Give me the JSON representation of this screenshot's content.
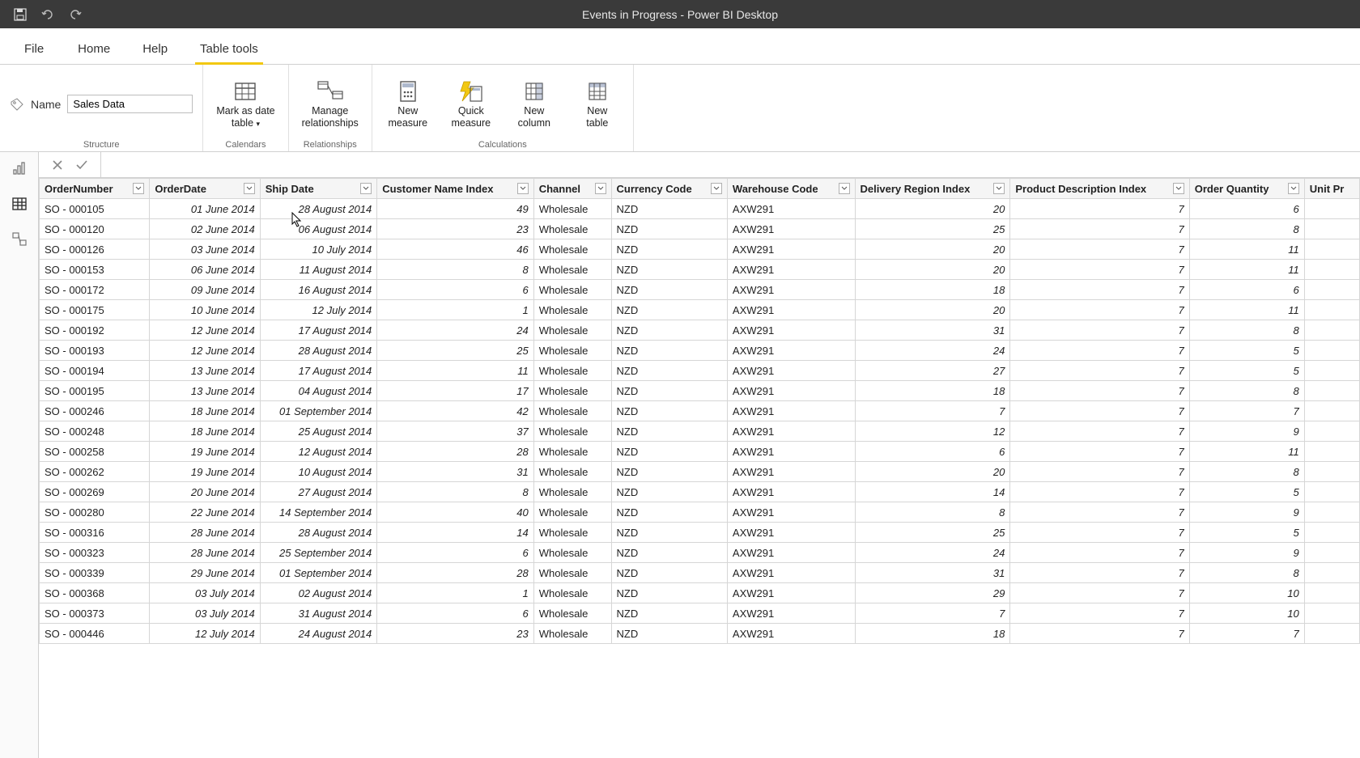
{
  "app": {
    "title": "Events in Progress - Power BI Desktop"
  },
  "tabs": {
    "file": "File",
    "home": "Home",
    "help": "Help",
    "table_tools": "Table tools"
  },
  "ribbon": {
    "name_label": "Name",
    "name_value": "Sales Data",
    "mark_date": "Mark as date\ntable",
    "manage_rel": "Manage\nrelationships",
    "new_measure": "New\nmeasure",
    "quick_measure": "Quick\nmeasure",
    "new_column": "New\ncolumn",
    "new_table": "New\ntable",
    "g_structure": "Structure",
    "g_calendars": "Calendars",
    "g_relationships": "Relationships",
    "g_calculations": "Calculations"
  },
  "columns": [
    "OrderNumber",
    "OrderDate",
    "Ship Date",
    "Customer Name Index",
    "Channel",
    "Currency Code",
    "Warehouse Code",
    "Delivery Region Index",
    "Product Description Index",
    "Order Quantity",
    "Unit Pr"
  ],
  "rows": [
    [
      "SO - 000105",
      "01 June 2014",
      "28 August 2014",
      "49",
      "Wholesale",
      "NZD",
      "AXW291",
      "20",
      "7",
      "6",
      ""
    ],
    [
      "SO - 000120",
      "02 June 2014",
      "06 August 2014",
      "23",
      "Wholesale",
      "NZD",
      "AXW291",
      "25",
      "7",
      "8",
      ""
    ],
    [
      "SO - 000126",
      "03 June 2014",
      "10 July 2014",
      "46",
      "Wholesale",
      "NZD",
      "AXW291",
      "20",
      "7",
      "11",
      ""
    ],
    [
      "SO - 000153",
      "06 June 2014",
      "11 August 2014",
      "8",
      "Wholesale",
      "NZD",
      "AXW291",
      "20",
      "7",
      "11",
      ""
    ],
    [
      "SO - 000172",
      "09 June 2014",
      "16 August 2014",
      "6",
      "Wholesale",
      "NZD",
      "AXW291",
      "18",
      "7",
      "6",
      ""
    ],
    [
      "SO - 000175",
      "10 June 2014",
      "12 July 2014",
      "1",
      "Wholesale",
      "NZD",
      "AXW291",
      "20",
      "7",
      "11",
      ""
    ],
    [
      "SO - 000192",
      "12 June 2014",
      "17 August 2014",
      "24",
      "Wholesale",
      "NZD",
      "AXW291",
      "31",
      "7",
      "8",
      ""
    ],
    [
      "SO - 000193",
      "12 June 2014",
      "28 August 2014",
      "25",
      "Wholesale",
      "NZD",
      "AXW291",
      "24",
      "7",
      "5",
      ""
    ],
    [
      "SO - 000194",
      "13 June 2014",
      "17 August 2014",
      "11",
      "Wholesale",
      "NZD",
      "AXW291",
      "27",
      "7",
      "5",
      ""
    ],
    [
      "SO - 000195",
      "13 June 2014",
      "04 August 2014",
      "17",
      "Wholesale",
      "NZD",
      "AXW291",
      "18",
      "7",
      "8",
      ""
    ],
    [
      "SO - 000246",
      "18 June 2014",
      "01 September 2014",
      "42",
      "Wholesale",
      "NZD",
      "AXW291",
      "7",
      "7",
      "7",
      ""
    ],
    [
      "SO - 000248",
      "18 June 2014",
      "25 August 2014",
      "37",
      "Wholesale",
      "NZD",
      "AXW291",
      "12",
      "7",
      "9",
      ""
    ],
    [
      "SO - 000258",
      "19 June 2014",
      "12 August 2014",
      "28",
      "Wholesale",
      "NZD",
      "AXW291",
      "6",
      "7",
      "11",
      ""
    ],
    [
      "SO - 000262",
      "19 June 2014",
      "10 August 2014",
      "31",
      "Wholesale",
      "NZD",
      "AXW291",
      "20",
      "7",
      "8",
      ""
    ],
    [
      "SO - 000269",
      "20 June 2014",
      "27 August 2014",
      "8",
      "Wholesale",
      "NZD",
      "AXW291",
      "14",
      "7",
      "5",
      ""
    ],
    [
      "SO - 000280",
      "22 June 2014",
      "14 September 2014",
      "40",
      "Wholesale",
      "NZD",
      "AXW291",
      "8",
      "7",
      "9",
      ""
    ],
    [
      "SO - 000316",
      "28 June 2014",
      "28 August 2014",
      "14",
      "Wholesale",
      "NZD",
      "AXW291",
      "25",
      "7",
      "5",
      ""
    ],
    [
      "SO - 000323",
      "28 June 2014",
      "25 September 2014",
      "6",
      "Wholesale",
      "NZD",
      "AXW291",
      "24",
      "7",
      "9",
      ""
    ],
    [
      "SO - 000339",
      "29 June 2014",
      "01 September 2014",
      "28",
      "Wholesale",
      "NZD",
      "AXW291",
      "31",
      "7",
      "8",
      ""
    ],
    [
      "SO - 000368",
      "03 July 2014",
      "02 August 2014",
      "1",
      "Wholesale",
      "NZD",
      "AXW291",
      "29",
      "7",
      "10",
      ""
    ],
    [
      "SO - 000373",
      "03 July 2014",
      "31 August 2014",
      "6",
      "Wholesale",
      "NZD",
      "AXW291",
      "7",
      "7",
      "10",
      ""
    ],
    [
      "SO - 000446",
      "12 July 2014",
      "24 August 2014",
      "23",
      "Wholesale",
      "NZD",
      "AXW291",
      "18",
      "7",
      "7",
      ""
    ]
  ]
}
